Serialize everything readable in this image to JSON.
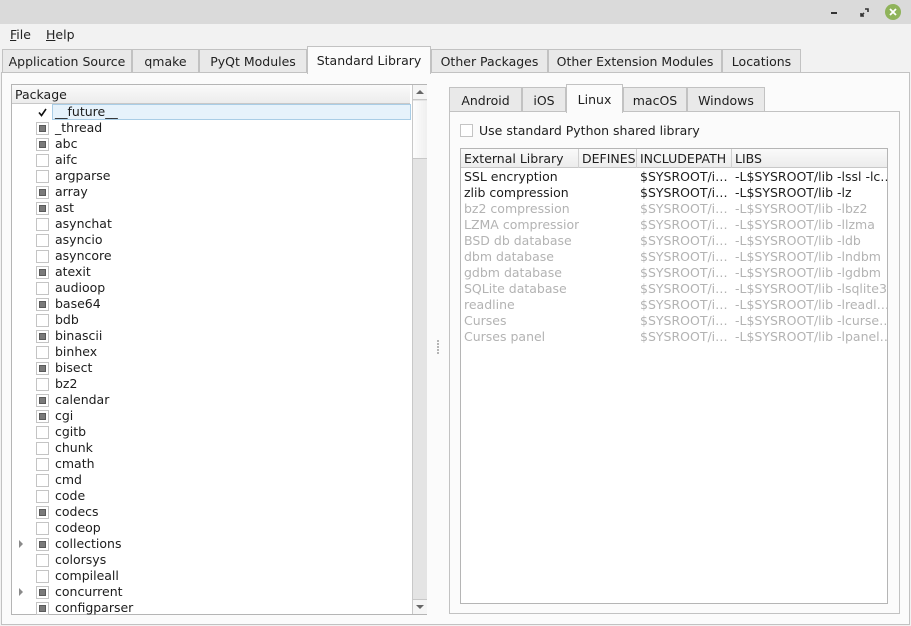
{
  "window": {
    "controls": [
      "minimize",
      "restore",
      "close"
    ],
    "close_color": "#8fb35a"
  },
  "menu": {
    "file": {
      "mnemonic": "F",
      "rest": "ile"
    },
    "help": {
      "mnemonic": "H",
      "rest": "elp"
    }
  },
  "tabs": [
    {
      "label": "Application Source",
      "active": false
    },
    {
      "label": "qmake",
      "active": false
    },
    {
      "label": "PyQt Modules",
      "active": false
    },
    {
      "label": "Standard Library",
      "active": true
    },
    {
      "label": "Other Packages",
      "active": false
    },
    {
      "label": "Other Extension Modules",
      "active": false
    },
    {
      "label": "Locations",
      "active": false
    }
  ],
  "package_tree": {
    "header": "Package",
    "items": [
      {
        "name": "__future__",
        "state": "checked",
        "expandable": false,
        "selected": true
      },
      {
        "name": "_thread",
        "state": "partial",
        "expandable": false
      },
      {
        "name": "abc",
        "state": "partial",
        "expandable": false
      },
      {
        "name": "aifc",
        "state": "unchecked",
        "expandable": false
      },
      {
        "name": "argparse",
        "state": "unchecked",
        "expandable": false
      },
      {
        "name": "array",
        "state": "partial",
        "expandable": false
      },
      {
        "name": "ast",
        "state": "partial",
        "expandable": false
      },
      {
        "name": "asynchat",
        "state": "unchecked",
        "expandable": false
      },
      {
        "name": "asyncio",
        "state": "unchecked",
        "expandable": false
      },
      {
        "name": "asyncore",
        "state": "unchecked",
        "expandable": false
      },
      {
        "name": "atexit",
        "state": "partial",
        "expandable": false
      },
      {
        "name": "audioop",
        "state": "unchecked",
        "expandable": false
      },
      {
        "name": "base64",
        "state": "partial",
        "expandable": false
      },
      {
        "name": "bdb",
        "state": "unchecked",
        "expandable": false
      },
      {
        "name": "binascii",
        "state": "partial",
        "expandable": false
      },
      {
        "name": "binhex",
        "state": "unchecked",
        "expandable": false
      },
      {
        "name": "bisect",
        "state": "partial",
        "expandable": false
      },
      {
        "name": "bz2",
        "state": "unchecked",
        "expandable": false
      },
      {
        "name": "calendar",
        "state": "partial",
        "expandable": false
      },
      {
        "name": "cgi",
        "state": "partial",
        "expandable": false
      },
      {
        "name": "cgitb",
        "state": "unchecked",
        "expandable": false
      },
      {
        "name": "chunk",
        "state": "unchecked",
        "expandable": false
      },
      {
        "name": "cmath",
        "state": "unchecked",
        "expandable": false
      },
      {
        "name": "cmd",
        "state": "unchecked",
        "expandable": false
      },
      {
        "name": "code",
        "state": "unchecked",
        "expandable": false
      },
      {
        "name": "codecs",
        "state": "partial",
        "expandable": false
      },
      {
        "name": "codeop",
        "state": "unchecked",
        "expandable": false
      },
      {
        "name": "collections",
        "state": "partial",
        "expandable": true
      },
      {
        "name": "colorsys",
        "state": "unchecked",
        "expandable": false
      },
      {
        "name": "compileall",
        "state": "unchecked",
        "expandable": false
      },
      {
        "name": "concurrent",
        "state": "partial",
        "expandable": true
      },
      {
        "name": "configparser",
        "state": "partial",
        "expandable": false
      }
    ]
  },
  "platform_tabs": [
    {
      "label": "Android",
      "active": false
    },
    {
      "label": "iOS",
      "active": false
    },
    {
      "label": "Linux",
      "active": true
    },
    {
      "label": "macOS",
      "active": false
    },
    {
      "label": "Windows",
      "active": false
    }
  ],
  "use_standard_python_shared_library": {
    "label": "Use standard Python shared library",
    "checked": false
  },
  "external_libraries": {
    "columns": [
      "External Library",
      "DEFINES",
      "INCLUDEPATH",
      "LIBS"
    ],
    "rows": [
      {
        "name": "SSL encryption",
        "defines": "",
        "includepath": "$SYSROOT/i…",
        "libs": "-L$SYSROOT/lib -lssl -lc…",
        "enabled": true
      },
      {
        "name": "zlib compression",
        "defines": "",
        "includepath": "$SYSROOT/i…",
        "libs": "-L$SYSROOT/lib -lz",
        "enabled": true
      },
      {
        "name": "bz2 compression",
        "defines": "",
        "includepath": "$SYSROOT/i…",
        "libs": "-L$SYSROOT/lib -lbz2",
        "enabled": false
      },
      {
        "name": "LZMA compression",
        "defines": "",
        "includepath": "$SYSROOT/i…",
        "libs": "-L$SYSROOT/lib -llzma",
        "enabled": false
      },
      {
        "name": "BSD db database",
        "defines": "",
        "includepath": "$SYSROOT/i…",
        "libs": "-L$SYSROOT/lib -ldb",
        "enabled": false
      },
      {
        "name": "dbm database",
        "defines": "",
        "includepath": "$SYSROOT/i…",
        "libs": "-L$SYSROOT/lib -lndbm",
        "enabled": false
      },
      {
        "name": "gdbm database",
        "defines": "",
        "includepath": "$SYSROOT/i…",
        "libs": "-L$SYSROOT/lib -lgdbm",
        "enabled": false
      },
      {
        "name": "SQLite database",
        "defines": "",
        "includepath": "$SYSROOT/i…",
        "libs": "-L$SYSROOT/lib -lsqlite3",
        "enabled": false
      },
      {
        "name": "readline",
        "defines": "",
        "includepath": "$SYSROOT/i…",
        "libs": "-L$SYSROOT/lib -lreadl…",
        "enabled": false
      },
      {
        "name": "Curses",
        "defines": "",
        "includepath": "$SYSROOT/i…",
        "libs": "-L$SYSROOT/lib -lcurse…",
        "enabled": false
      },
      {
        "name": "Curses panel",
        "defines": "",
        "includepath": "$SYSROOT/i…",
        "libs": "-L$SYSROOT/lib -lpanel…",
        "enabled": false
      }
    ]
  }
}
